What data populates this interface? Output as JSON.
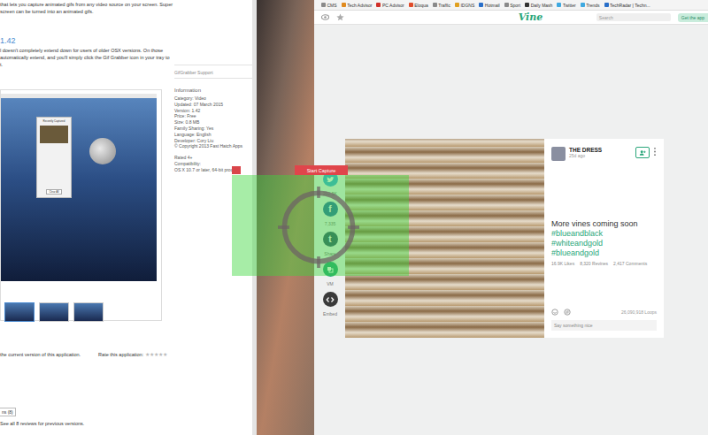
{
  "app_store": {
    "description": [
      "that lets you capture animated gifs from any video source on your screen. Super",
      "screen can be turned into an animated gifs."
    ],
    "version_heading": "1.42",
    "whats_new": [
      "l doesn't completely extend down for users of older OSX versions. On those",
      "automatically extend, and you'll simply click the Gif Grabber icon in your tray to",
      "t."
    ],
    "support_link": "GifGrabber Support",
    "info_title": "Information",
    "info": [
      "Category: Video",
      "Updated: 07 March 2015",
      "Version: 1.42",
      "Price: Free",
      "Size: 0.8 MB",
      "Family Sharing: Yes",
      "Language: English",
      "Developer: Cory Liu",
      "© Copyright 2013 Fast Hatch Apps"
    ],
    "rating": "Rated 4+",
    "compatibility_label": "Compatibility:",
    "compatibility": "OS X 10.7 or later, 64-bit process",
    "screenshot_popup": {
      "title": "Recently Captured",
      "button": "Clear All"
    },
    "thumbnails": [
      {
        "selected": true
      },
      {
        "selected": false
      },
      {
        "selected": false
      }
    ],
    "rate_note": "the current version of this application.",
    "rate_label": "Rate this application:",
    "star_glyph": "★",
    "stars": 0,
    "star_total": 5,
    "reviews_button": "ns (8)",
    "reviews_link": "See all 8 reviews for previous versions."
  },
  "capture": {
    "button": "Start Capture"
  },
  "browser": {
    "bookmarks": [
      {
        "label": "CMS",
        "color": "#8a8a8a"
      },
      {
        "label": "Tech Advisor",
        "color": "#e08a1e"
      },
      {
        "label": "PC Advisor",
        "color": "#d0302a"
      },
      {
        "label": "Eloqua",
        "color": "#e04b2a"
      },
      {
        "label": "Traffic",
        "color": "#8a8a8a"
      },
      {
        "label": "IDGNS",
        "color": "#e0a020"
      },
      {
        "label": "Hotmail",
        "color": "#2a6fc9"
      },
      {
        "label": "Sport",
        "color": "#8a8a8a"
      },
      {
        "label": "Daily Mash",
        "color": "#333333"
      },
      {
        "label": "Twitter",
        "color": "#3fa9e0"
      },
      {
        "label": "Trends",
        "color": "#3fa9e0"
      },
      {
        "label": "TechRadar | Techn...",
        "color": "#2a6fc9"
      }
    ],
    "logo": "Vine",
    "search_placeholder": "Search",
    "get_app": "Get the app"
  },
  "post": {
    "author": "THE DRESS",
    "time": "25d ago",
    "caption": "More vines coming soon",
    "hashtags": [
      "#blueandblack",
      "#whiteandgold",
      "#blueandgold"
    ],
    "stats": [
      "16.9K Likes",
      "8,320 Revines",
      "2,417 Comments"
    ],
    "loops": "26,090,918 Loops",
    "comment_placeholder": "Say something nice"
  },
  "share": [
    {
      "kind": "twitter",
      "glyph": "",
      "label": "202.5K",
      "color": "#3fa9e0"
    },
    {
      "kind": "glyph",
      "glyph": "f",
      "label": "7,335",
      "color": "#2d6ea8"
    },
    {
      "kind": "glyph",
      "glyph": "t",
      "label": "Share",
      "color": "#36556e"
    },
    {
      "kind": "vm",
      "glyph": "",
      "label": "VM",
      "color": "#2aa67a"
    },
    {
      "kind": "embed",
      "glyph": "",
      "label": "Embed",
      "color": "#3a3a3a"
    }
  ]
}
